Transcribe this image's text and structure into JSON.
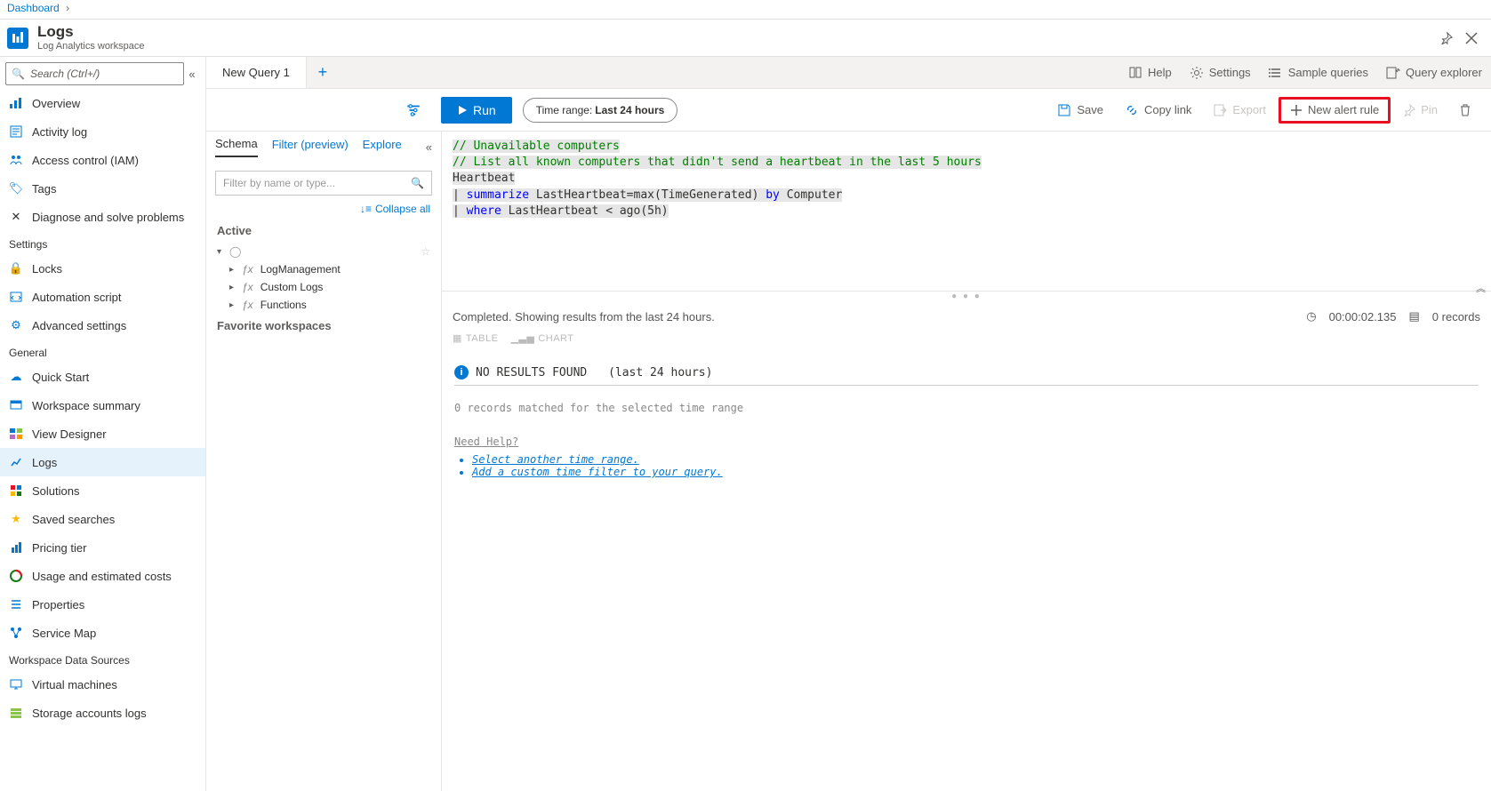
{
  "breadcrumb": {
    "root": "Dashboard"
  },
  "header": {
    "title": "Logs",
    "subtitle": "Log Analytics workspace"
  },
  "sidebar": {
    "search_placeholder": "Search (Ctrl+/)",
    "groups": [
      {
        "heading": null,
        "items": [
          {
            "label": "Overview",
            "icon": "overview",
            "selected": false
          },
          {
            "label": "Activity log",
            "icon": "activity",
            "selected": false
          },
          {
            "label": "Access control (IAM)",
            "icon": "iam",
            "selected": false
          },
          {
            "label": "Tags",
            "icon": "tags",
            "selected": false
          },
          {
            "label": "Diagnose and solve problems",
            "icon": "diagnose",
            "selected": false
          }
        ]
      },
      {
        "heading": "Settings",
        "items": [
          {
            "label": "Locks",
            "icon": "lock",
            "selected": false
          },
          {
            "label": "Automation script",
            "icon": "script",
            "selected": false
          },
          {
            "label": "Advanced settings",
            "icon": "gear",
            "selected": false
          }
        ]
      },
      {
        "heading": "General",
        "items": [
          {
            "label": "Quick Start",
            "icon": "quickstart",
            "selected": false
          },
          {
            "label": "Workspace summary",
            "icon": "workspace",
            "selected": false
          },
          {
            "label": "View Designer",
            "icon": "viewdesigner",
            "selected": false
          },
          {
            "label": "Logs",
            "icon": "logs",
            "selected": true
          },
          {
            "label": "Solutions",
            "icon": "solutions",
            "selected": false
          },
          {
            "label": "Saved searches",
            "icon": "star",
            "selected": false
          },
          {
            "label": "Pricing tier",
            "icon": "pricing",
            "selected": false
          },
          {
            "label": "Usage and estimated costs",
            "icon": "usage",
            "selected": false
          },
          {
            "label": "Properties",
            "icon": "properties",
            "selected": false
          },
          {
            "label": "Service Map",
            "icon": "servicemap",
            "selected": false
          }
        ]
      },
      {
        "heading": "Workspace Data Sources",
        "items": [
          {
            "label": "Virtual machines",
            "icon": "vm",
            "selected": false
          },
          {
            "label": "Storage accounts logs",
            "icon": "storage",
            "selected": false
          }
        ]
      }
    ]
  },
  "top_utility": {
    "help": "Help",
    "settings": "Settings",
    "sample_queries": "Sample queries",
    "query_explorer": "Query explorer"
  },
  "tabs": [
    {
      "label": "New Query 1"
    }
  ],
  "toolbar": {
    "run": "Run",
    "time_range_label": "Time range:",
    "time_range_value": "Last 24 hours",
    "save": "Save",
    "copy_link": "Copy link",
    "export": "Export",
    "new_alert_rule": "New alert rule",
    "pin": "Pin"
  },
  "schema": {
    "tabs": {
      "schema": "Schema",
      "filter": "Filter (preview)",
      "explore": "Explore"
    },
    "filter_placeholder": "Filter by name or type...",
    "collapse_all": "Collapse all",
    "active": "Active",
    "tree": [
      {
        "label": "LogManagement"
      },
      {
        "label": "Custom Logs"
      },
      {
        "label": "Functions"
      }
    ],
    "favorite_workspaces": "Favorite workspaces"
  },
  "editor": {
    "lines": [
      {
        "text": "// Unavailable computers",
        "type": "comment"
      },
      {
        "text": "// List all known computers that didn't send a heartbeat in the last 5 hours",
        "type": "comment"
      },
      {
        "text": "Heartbeat",
        "type": "plain"
      },
      {
        "prefix": "| ",
        "kw": "summarize",
        "rest": " LastHeartbeat=max(TimeGenerated) ",
        "by": "by",
        "tail": " Computer"
      },
      {
        "prefix": "| ",
        "kw": "where",
        "rest": " LastHeartbeat < ago(5h)"
      }
    ]
  },
  "results": {
    "status": "Completed. Showing results from the last 24 hours.",
    "duration": "00:00:02.135",
    "records": "0 records",
    "view_table": "TABLE",
    "view_chart": "CHART",
    "no_results_title": "NO RESULTS FOUND",
    "no_results_range": "(last 24 hours)",
    "zero_matched": "0 records matched for the selected time range",
    "need_help": "Need Help?",
    "help_links": [
      "Select another time range.",
      "Add a custom time filter to your query."
    ]
  }
}
